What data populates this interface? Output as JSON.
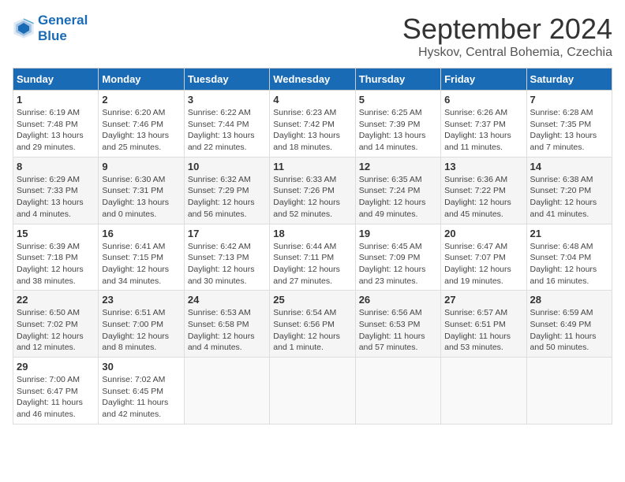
{
  "logo": {
    "line1": "General",
    "line2": "Blue"
  },
  "title": "September 2024",
  "subtitle": "Hyskov, Central Bohemia, Czechia",
  "days_header": [
    "Sunday",
    "Monday",
    "Tuesday",
    "Wednesday",
    "Thursday",
    "Friday",
    "Saturday"
  ],
  "weeks": [
    [
      {
        "num": "1",
        "detail": "Sunrise: 6:19 AM\nSunset: 7:48 PM\nDaylight: 13 hours\nand 29 minutes."
      },
      {
        "num": "2",
        "detail": "Sunrise: 6:20 AM\nSunset: 7:46 PM\nDaylight: 13 hours\nand 25 minutes."
      },
      {
        "num": "3",
        "detail": "Sunrise: 6:22 AM\nSunset: 7:44 PM\nDaylight: 13 hours\nand 22 minutes."
      },
      {
        "num": "4",
        "detail": "Sunrise: 6:23 AM\nSunset: 7:42 PM\nDaylight: 13 hours\nand 18 minutes."
      },
      {
        "num": "5",
        "detail": "Sunrise: 6:25 AM\nSunset: 7:39 PM\nDaylight: 13 hours\nand 14 minutes."
      },
      {
        "num": "6",
        "detail": "Sunrise: 6:26 AM\nSunset: 7:37 PM\nDaylight: 13 hours\nand 11 minutes."
      },
      {
        "num": "7",
        "detail": "Sunrise: 6:28 AM\nSunset: 7:35 PM\nDaylight: 13 hours\nand 7 minutes."
      }
    ],
    [
      {
        "num": "8",
        "detail": "Sunrise: 6:29 AM\nSunset: 7:33 PM\nDaylight: 13 hours\nand 4 minutes."
      },
      {
        "num": "9",
        "detail": "Sunrise: 6:30 AM\nSunset: 7:31 PM\nDaylight: 13 hours\nand 0 minutes."
      },
      {
        "num": "10",
        "detail": "Sunrise: 6:32 AM\nSunset: 7:29 PM\nDaylight: 12 hours\nand 56 minutes."
      },
      {
        "num": "11",
        "detail": "Sunrise: 6:33 AM\nSunset: 7:26 PM\nDaylight: 12 hours\nand 52 minutes."
      },
      {
        "num": "12",
        "detail": "Sunrise: 6:35 AM\nSunset: 7:24 PM\nDaylight: 12 hours\nand 49 minutes."
      },
      {
        "num": "13",
        "detail": "Sunrise: 6:36 AM\nSunset: 7:22 PM\nDaylight: 12 hours\nand 45 minutes."
      },
      {
        "num": "14",
        "detail": "Sunrise: 6:38 AM\nSunset: 7:20 PM\nDaylight: 12 hours\nand 41 minutes."
      }
    ],
    [
      {
        "num": "15",
        "detail": "Sunrise: 6:39 AM\nSunset: 7:18 PM\nDaylight: 12 hours\nand 38 minutes."
      },
      {
        "num": "16",
        "detail": "Sunrise: 6:41 AM\nSunset: 7:15 PM\nDaylight: 12 hours\nand 34 minutes."
      },
      {
        "num": "17",
        "detail": "Sunrise: 6:42 AM\nSunset: 7:13 PM\nDaylight: 12 hours\nand 30 minutes."
      },
      {
        "num": "18",
        "detail": "Sunrise: 6:44 AM\nSunset: 7:11 PM\nDaylight: 12 hours\nand 27 minutes."
      },
      {
        "num": "19",
        "detail": "Sunrise: 6:45 AM\nSunset: 7:09 PM\nDaylight: 12 hours\nand 23 minutes."
      },
      {
        "num": "20",
        "detail": "Sunrise: 6:47 AM\nSunset: 7:07 PM\nDaylight: 12 hours\nand 19 minutes."
      },
      {
        "num": "21",
        "detail": "Sunrise: 6:48 AM\nSunset: 7:04 PM\nDaylight: 12 hours\nand 16 minutes."
      }
    ],
    [
      {
        "num": "22",
        "detail": "Sunrise: 6:50 AM\nSunset: 7:02 PM\nDaylight: 12 hours\nand 12 minutes."
      },
      {
        "num": "23",
        "detail": "Sunrise: 6:51 AM\nSunset: 7:00 PM\nDaylight: 12 hours\nand 8 minutes."
      },
      {
        "num": "24",
        "detail": "Sunrise: 6:53 AM\nSunset: 6:58 PM\nDaylight: 12 hours\nand 4 minutes."
      },
      {
        "num": "25",
        "detail": "Sunrise: 6:54 AM\nSunset: 6:56 PM\nDaylight: 12 hours\nand 1 minute."
      },
      {
        "num": "26",
        "detail": "Sunrise: 6:56 AM\nSunset: 6:53 PM\nDaylight: 11 hours\nand 57 minutes."
      },
      {
        "num": "27",
        "detail": "Sunrise: 6:57 AM\nSunset: 6:51 PM\nDaylight: 11 hours\nand 53 minutes."
      },
      {
        "num": "28",
        "detail": "Sunrise: 6:59 AM\nSunset: 6:49 PM\nDaylight: 11 hours\nand 50 minutes."
      }
    ],
    [
      {
        "num": "29",
        "detail": "Sunrise: 7:00 AM\nSunset: 6:47 PM\nDaylight: 11 hours\nand 46 minutes."
      },
      {
        "num": "30",
        "detail": "Sunrise: 7:02 AM\nSunset: 6:45 PM\nDaylight: 11 hours\nand 42 minutes."
      },
      {
        "num": "",
        "detail": ""
      },
      {
        "num": "",
        "detail": ""
      },
      {
        "num": "",
        "detail": ""
      },
      {
        "num": "",
        "detail": ""
      },
      {
        "num": "",
        "detail": ""
      }
    ]
  ]
}
